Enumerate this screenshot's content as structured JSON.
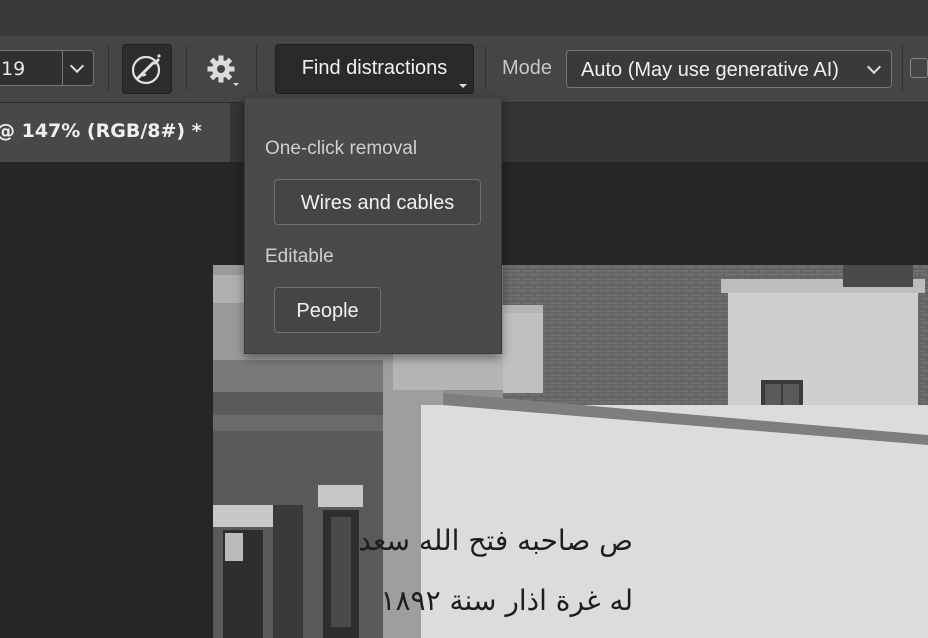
{
  "toolbar": {
    "brush_size_value": "19",
    "find_distractions_label": "Find distractions",
    "mode_label": "Mode",
    "mode_value": "Auto (May use generative AI)"
  },
  "document": {
    "tab_title": "@ 147% (RGB/8#) *"
  },
  "find_distractions_menu": {
    "section_one_click_header": "One-click removal",
    "wires_and_cables_label": "Wires and cables",
    "section_editable_header": "Editable",
    "people_label": "People"
  },
  "photo": {
    "sign_line_1": "ص صاحبه فتح الله سعد",
    "sign_line_2": "له غرة اذار سنة ١٨٩٢"
  },
  "icons": {
    "brush": "remove-brush-icon",
    "settings": "gear-icon",
    "dropdown": "chevron-down-icon"
  }
}
